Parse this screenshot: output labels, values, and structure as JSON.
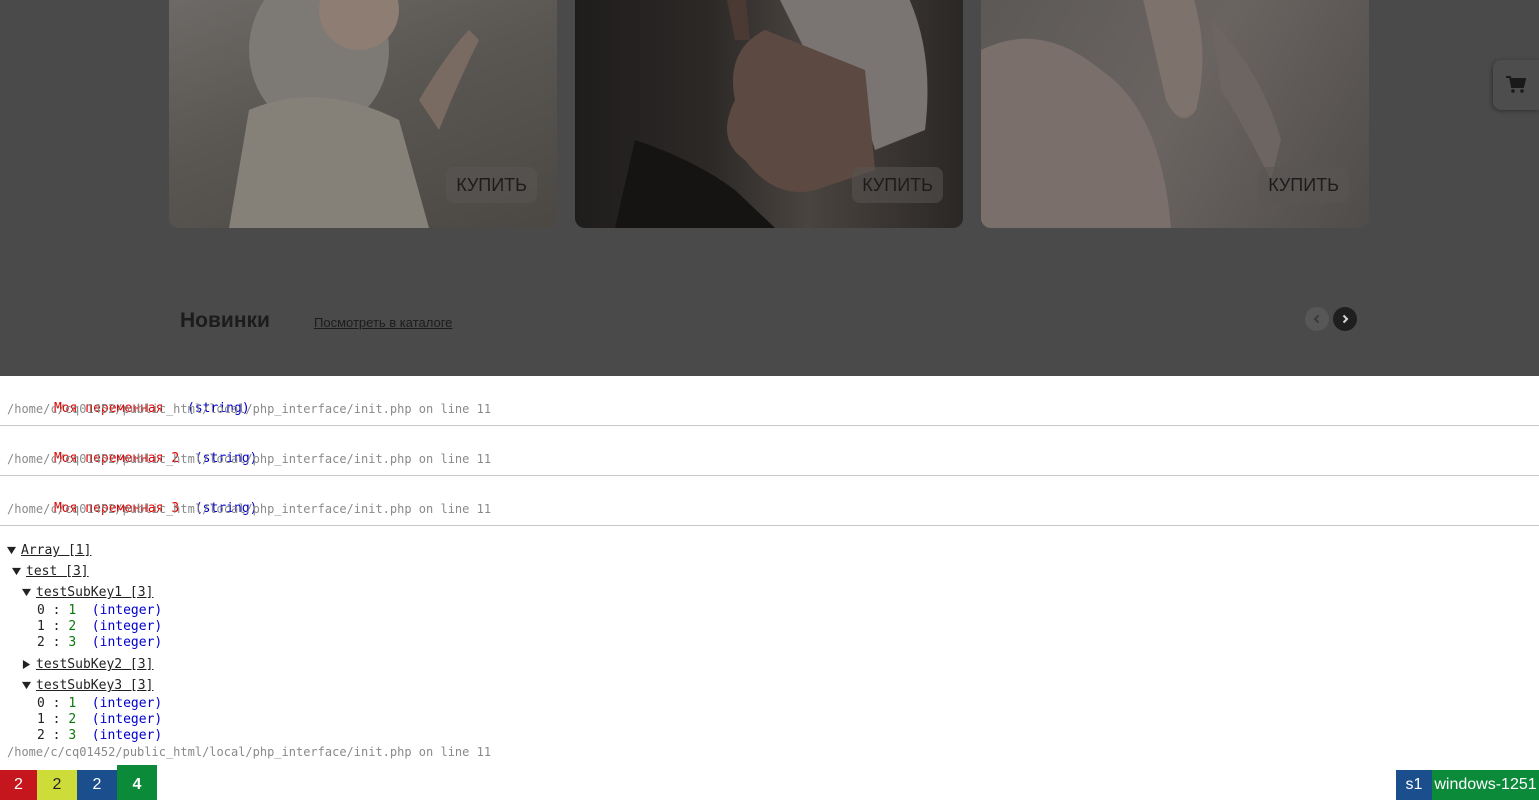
{
  "products": [
    {
      "buy_label": "КУПИТЬ"
    },
    {
      "buy_label": "КУПИТЬ"
    },
    {
      "buy_label": "КУПИТЬ"
    }
  ],
  "section": {
    "title": "Новинки",
    "catalog_link": "Посмотреть в каталоге"
  },
  "debug": {
    "vars": [
      {
        "name": "Моя переменная ",
        "type": "(string)",
        "path": "/home/c/cq01452/public_html/local/php_interface/init.php on line 11"
      },
      {
        "name": "Моя переменная 2",
        "type": "(string)",
        "path": "/home/c/cq01452/public_html/local/php_interface/init.php on line 11"
      },
      {
        "name": "Моя переменная 3",
        "type": "(string)",
        "path": "/home/c/cq01452/public_html/local/php_interface/init.php on line 11"
      }
    ],
    "tree": {
      "root": "Array [1]",
      "test": "test [3]",
      "sub1": "testSubKey1 [3]",
      "sub1_items": [
        {
          "idx": "0 :",
          "val": "1",
          "type": "(integer)"
        },
        {
          "idx": "1 :",
          "val": "2",
          "type": "(integer)"
        },
        {
          "idx": "2 :",
          "val": "3",
          "type": "(integer)"
        }
      ],
      "sub2": "testSubKey2 [3]",
      "sub3": "testSubKey3 [3]",
      "sub3_items": [
        {
          "idx": "0 :",
          "val": "1",
          "type": "(integer)"
        },
        {
          "idx": "1 :",
          "val": "2",
          "type": "(integer)"
        },
        {
          "idx": "2 :",
          "val": "3",
          "type": "(integer)"
        }
      ],
      "path": "/home/c/cq01452/public_html/local/php_interface/init.php on line 11"
    }
  },
  "status_bar": {
    "red": "2",
    "yellow": "2",
    "blue": "2",
    "green": "4",
    "site": "s1",
    "charset": "windows-1251"
  },
  "icons": {
    "cart": "cart-icon",
    "prev": "chevron-left-icon",
    "next": "chevron-right-icon",
    "expanded": "triangle-down-icon",
    "collapsed": "triangle-right-icon"
  }
}
